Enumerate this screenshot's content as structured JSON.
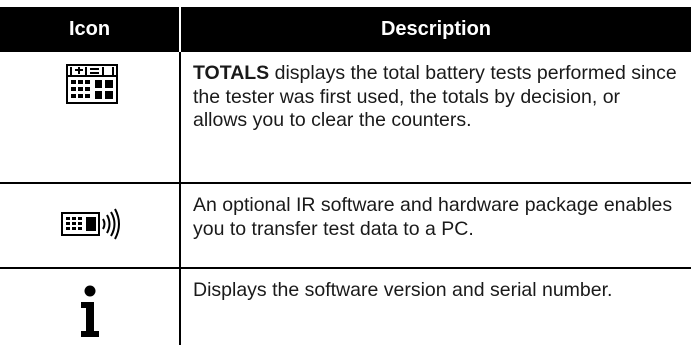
{
  "table": {
    "headers": {
      "icon": "Icon",
      "description": "Description"
    },
    "rows": [
      {
        "icon": "totals-icon",
        "bold_prefix": "TOTALS",
        "text": " displays the total battery tests performed since the tester was first used, the totals by decision, or allows you to clear the counters."
      },
      {
        "icon": "ir-transfer-icon",
        "bold_prefix": "",
        "text": "An optional IR software and hardware package enables you to transfer test data to a PC."
      },
      {
        "icon": "info-icon",
        "bold_prefix": "",
        "text": "Displays the software version and serial number."
      }
    ]
  }
}
